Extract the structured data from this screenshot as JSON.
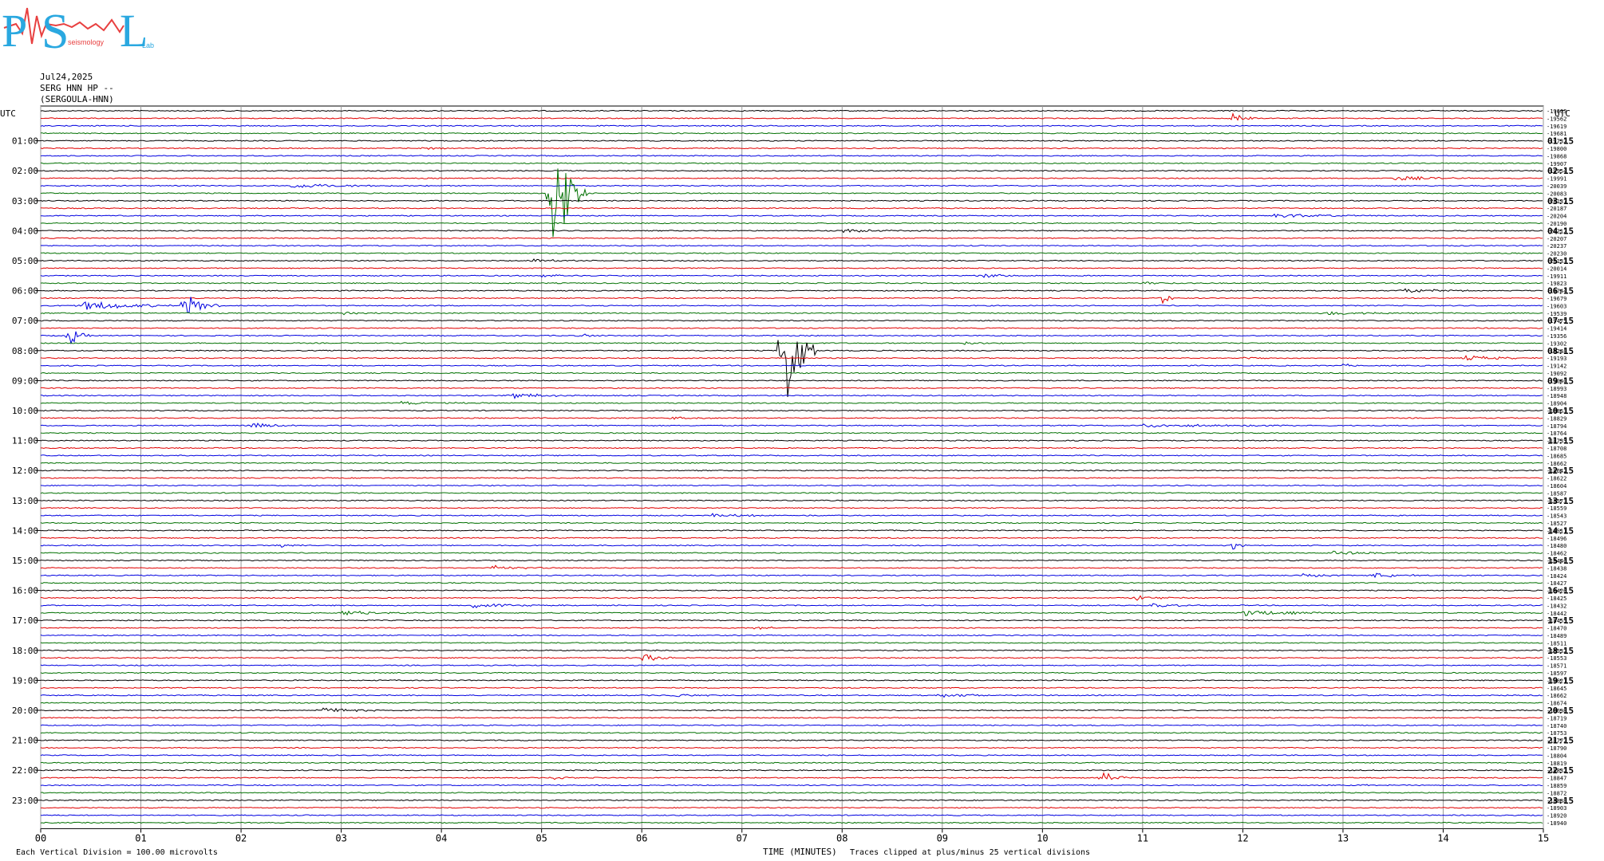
{
  "logo": {
    "letters": [
      "P",
      "S",
      "L"
    ],
    "small_words": [
      "seismology",
      "Lab"
    ]
  },
  "header": {
    "date": "Jul24,2025",
    "station": "SERG HNN HP --",
    "station_name": "(SERGOULA-HNN)"
  },
  "left_axis_title": "UTC",
  "right_axis_title": "UTC",
  "footer": {
    "scale_note": "Each Vertical Division =  100.00 microvolts",
    "x_title": "TIME (MINUTES)",
    "clip_note": "Traces clipped at plus/minus 25 vertical divisions"
  },
  "colors": {
    "trace_cycle": [
      "#000000",
      "#e00000",
      "#0000e0",
      "#007000"
    ],
    "gridline": "#999999"
  },
  "chart_data": {
    "type": "helicorder",
    "x_range": [
      0,
      15
    ],
    "x_ticks": [
      "00",
      "01",
      "02",
      "03",
      "04",
      "05",
      "06",
      "07",
      "08",
      "09",
      "10",
      "11",
      "12",
      "13",
      "14",
      "15"
    ],
    "left_hour_labels": [
      "01:00",
      "02:00",
      "03:00",
      "04:00",
      "05:00",
      "06:00",
      "07:00",
      "08:00",
      "09:00",
      "10:00",
      "11:00",
      "12:00",
      "13:00",
      "14:00",
      "15:00",
      "16:00",
      "17:00",
      "18:00",
      "19:00",
      "20:00",
      "21:00",
      "22:00",
      "23:00"
    ],
    "right_hour_labels": [
      "01:15",
      "02:15",
      "03:15",
      "04:15",
      "05:15",
      "06:15",
      "07:15",
      "08:15",
      "09:15",
      "10:15",
      "11:15",
      "12:15",
      "13:15",
      "14:15",
      "15:15",
      "16:15",
      "17:15",
      "18:15",
      "19:15",
      "20:15",
      "21:15",
      "22:15",
      "23:15"
    ],
    "trace_offsets": [
      "-19603",
      "-19562",
      "-19619",
      "-19681",
      "-19732",
      "-19800",
      "-19868",
      "-19907",
      "-19954",
      "-19991",
      "-20039",
      "-20083",
      "-20137",
      "-20187",
      "-20204",
      "-20190",
      "-20212",
      "-20207",
      "-20237",
      "-20230",
      "-20133",
      "-20014",
      "-19911",
      "-19823",
      "-19744",
      "-19679",
      "-19603",
      "-19539",
      "-19475",
      "-19414",
      "-19356",
      "-19302",
      "-19248",
      "-19193",
      "-19142",
      "-19092",
      "-19040",
      "-18993",
      "-18948",
      "-18904",
      "-18863",
      "-18829",
      "-18794",
      "-18764",
      "-18735",
      "-18708",
      "-18685",
      "-18662",
      "-18642",
      "-18622",
      "-18604",
      "-18587",
      "-18573",
      "-18559",
      "-18543",
      "-18527",
      "-18511",
      "-18496",
      "-18480",
      "-18462",
      "-18446",
      "-18438",
      "-18424",
      "-18427",
      "-18426",
      "-18425",
      "-18432",
      "-18442",
      "-18455",
      "-18470",
      "-18489",
      "-18511",
      "-18532",
      "-18553",
      "-18571",
      "-18597",
      "-18621",
      "-18645",
      "-18662",
      "-18674",
      "-18698",
      "-18719",
      "-18740",
      "-18753",
      "-18772",
      "-18790",
      "-18804",
      "-18819",
      "-18832",
      "-18847",
      "-18859",
      "-18872",
      "-18888",
      "-18903",
      "-18920",
      "-18940"
    ],
    "events": [
      {
        "row": 1,
        "minute": 11.9,
        "amp": 8,
        "dur": 0.3
      },
      {
        "row": 5,
        "minute": 3.85,
        "amp": 5,
        "dur": 0.3
      },
      {
        "row": 10,
        "minute": 2.5,
        "amp": 3,
        "dur": 1.5
      },
      {
        "row": 11,
        "minute": 5.1,
        "amp": 110,
        "dur": 0.35
      },
      {
        "row": 9,
        "minute": 13.5,
        "amp": 3,
        "dur": 1.0
      },
      {
        "row": 14,
        "minute": 12.3,
        "amp": 3,
        "dur": 1.2
      },
      {
        "row": 16,
        "minute": 8.0,
        "amp": 2,
        "dur": 1.5
      },
      {
        "row": 20,
        "minute": 4.9,
        "amp": 2,
        "dur": 0.7
      },
      {
        "row": 22,
        "minute": 9.4,
        "amp": 3,
        "dur": 0.6
      },
      {
        "row": 22,
        "minute": 5.0,
        "amp": 2,
        "dur": 1.0
      },
      {
        "row": 23,
        "minute": 11.0,
        "amp": 2,
        "dur": 0.6
      },
      {
        "row": 24,
        "minute": 13.6,
        "amp": 3,
        "dur": 1.0
      },
      {
        "row": 25,
        "minute": 11.2,
        "amp": 9,
        "dur": 0.15
      },
      {
        "row": 25,
        "minute": 15.0,
        "amp": 4,
        "dur": 0.2
      },
      {
        "row": 26,
        "minute": 0.4,
        "amp": 6,
        "dur": 1.3
      },
      {
        "row": 26,
        "minute": 1.45,
        "amp": 22,
        "dur": 0.35
      },
      {
        "row": 27,
        "minute": 3.0,
        "amp": 3,
        "dur": 0.4
      },
      {
        "row": 27,
        "minute": 12.8,
        "amp": 2,
        "dur": 1.5
      },
      {
        "row": 30,
        "minute": 0.3,
        "amp": 14,
        "dur": 0.2
      },
      {
        "row": 30,
        "minute": 5.4,
        "amp": 3,
        "dur": 0.3
      },
      {
        "row": 31,
        "minute": 9.2,
        "amp": 2,
        "dur": 0.8
      },
      {
        "row": 32,
        "minute": 7.4,
        "amp": 110,
        "dur": 0.35
      },
      {
        "row": 33,
        "minute": 12.0,
        "amp": 3,
        "dur": 0.4
      },
      {
        "row": 33,
        "minute": 14.2,
        "amp": 3,
        "dur": 1.0
      },
      {
        "row": 34,
        "minute": 13.0,
        "amp": 3,
        "dur": 0.2
      },
      {
        "row": 38,
        "minute": 4.7,
        "amp": 4,
        "dur": 0.8
      },
      {
        "row": 39,
        "minute": 3.6,
        "amp": 2,
        "dur": 1.2
      },
      {
        "row": 41,
        "minute": 6.3,
        "amp": 2,
        "dur": 0.8
      },
      {
        "row": 42,
        "minute": 2.1,
        "amp": 3,
        "dur": 0.8
      },
      {
        "row": 42,
        "minute": 11.0,
        "amp": 2,
        "dur": 2.5
      },
      {
        "row": 54,
        "minute": 6.7,
        "amp": 2,
        "dur": 1.3
      },
      {
        "row": 58,
        "minute": 11.9,
        "amp": 6,
        "dur": 0.15
      },
      {
        "row": 58,
        "minute": 2.4,
        "amp": 3,
        "dur": 0.3
      },
      {
        "row": 59,
        "minute": 12.9,
        "amp": 3,
        "dur": 1.0
      },
      {
        "row": 61,
        "minute": 4.5,
        "amp": 3,
        "dur": 0.8
      },
      {
        "row": 62,
        "minute": 12.6,
        "amp": 3,
        "dur": 0.8
      },
      {
        "row": 62,
        "minute": 13.3,
        "amp": 3,
        "dur": 0.8
      },
      {
        "row": 65,
        "minute": 10.9,
        "amp": 3,
        "dur": 0.8
      },
      {
        "row": 66,
        "minute": 4.3,
        "amp": 3,
        "dur": 1.0
      },
      {
        "row": 66,
        "minute": 11.1,
        "amp": 3,
        "dur": 0.6
      },
      {
        "row": 67,
        "minute": 3.0,
        "amp": 3,
        "dur": 1.0
      },
      {
        "row": 67,
        "minute": 12.0,
        "amp": 4,
        "dur": 1.2
      },
      {
        "row": 69,
        "minute": 7.1,
        "amp": 2,
        "dur": 0.6
      },
      {
        "row": 73,
        "minute": 6.0,
        "amp": 5,
        "dur": 0.5
      },
      {
        "row": 78,
        "minute": 6.3,
        "amp": 2,
        "dur": 0.8
      },
      {
        "row": 78,
        "minute": 9.0,
        "amp": 3,
        "dur": 0.8
      },
      {
        "row": 80,
        "minute": 2.8,
        "amp": 3,
        "dur": 1.0
      },
      {
        "row": 89,
        "minute": 10.6,
        "amp": 9,
        "dur": 0.35
      },
      {
        "row": 89,
        "minute": 5.1,
        "amp": 2,
        "dur": 0.5
      },
      {
        "row": 90,
        "minute": 13.2,
        "amp": 3,
        "dur": 0.1
      }
    ]
  }
}
